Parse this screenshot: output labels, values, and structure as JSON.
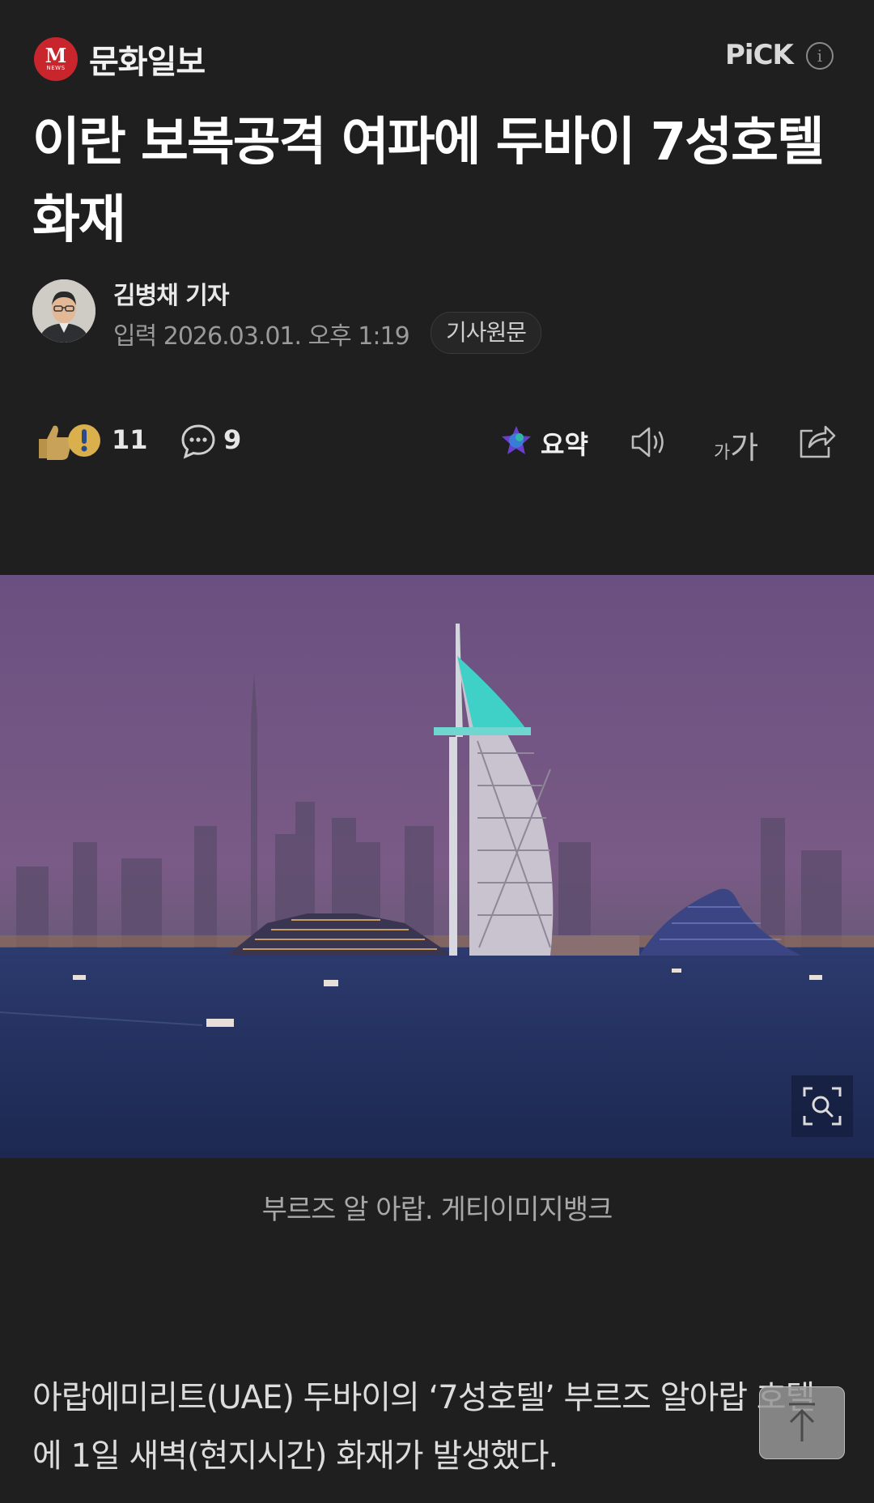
{
  "header": {
    "logo_letter": "M",
    "logo_sub": "NEWS",
    "press_name": "문화일보",
    "pick_label": "PiCK",
    "info_icon": "info-icon"
  },
  "article": {
    "title": "이란 보복공격 여파에 두바이 7성호텔 화재",
    "author": "김병채 기자",
    "date": "입력 2026.03.01. 오후 1:19",
    "origin_button": "기사원문"
  },
  "actions": {
    "reaction_count": "11",
    "comment_count": "9",
    "summary_label": "요약",
    "fontsize_small": "가",
    "fontsize_large": "가"
  },
  "photo": {
    "caption": "부르즈 알 아랍. 게티이미지뱅크",
    "zoom_icon": "zoom-icon"
  },
  "body": {
    "paragraph1": "아랍에미리트(UAE) 두바이의 ‘7성호텔’ 부르즈 알아랍 호텔에 1일 새벽(현지시간) 화재가 발생했다."
  },
  "colors": {
    "background": "#1f1f20",
    "brand_red": "#c8262c",
    "text_primary": "#ffffff",
    "text_secondary": "#9a9a9a"
  }
}
